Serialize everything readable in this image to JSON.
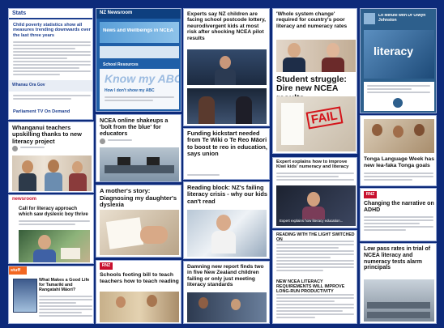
{
  "cards": {
    "stats": {
      "brand": "Stats",
      "headline": "Child poverty statistics show all measures trending downwards over the last three years",
      "footer_brand": "Whanau Ora Gov",
      "footer_text": "Parliament TV On Demand",
      "color": "#1d3f8f"
    },
    "news_school": {
      "top_label": "NZ Newsroom",
      "article_title": "News and Wellbeings in NCEA",
      "panel_label": "School Resources",
      "slogan": "Know my ABC",
      "caption": "How I don't show my ABC",
      "color": "#2a6fbd"
    },
    "experts": {
      "headline": "Experts say NZ children are facing school postcode lottery, neurodivergent kids at most risk after shocking NCEA pilot results",
      "color": "#1b2b4a"
    },
    "whole_system": {
      "headline": "'Whole system change' required for country's poor literacy and numeracy rates",
      "fail_label": "FAIL",
      "student_headline": "Student struggle: Dire new NCEA results"
    },
    "podcast": {
      "show_title": "Lit Minute with Dr Olwyn Johnston",
      "cover_word": "literacy",
      "color": "#2d5f8c"
    },
    "whanganui": {
      "headline": "Whanganui teachers upskilling thanks to new literacy project"
    },
    "ncea_shakeups": {
      "headline": "NCEA online shakeups a 'bolt from the blue' for educators"
    },
    "funding": {
      "headline": "Funding kickstart needed from Te Wiki o Te Reo Māori to boost te reo in education, says union"
    },
    "expert_improve": {
      "headline": "Expert explains how to improve Kiwi kids' numeracy and literacy",
      "video_caption": "Expert explains how literacy education..."
    },
    "tongan": {
      "headline": "Tonga Language Week has new lea-faka Tonga goals"
    },
    "dyslexia": {
      "headline": "A mother's story: Diagnosing my daughter's dyslexia"
    },
    "reading_block": {
      "headline": "Reading block: NZ's failing literacy crisis - why our kids can't read"
    },
    "call_for": {
      "headline": "Call for literacy approach which saw dyslexic boy thrive",
      "brand": "newsroom",
      "brand_color": "#c8102e"
    },
    "reading_light": {
      "headline": "READING WITH THE LIGHT SWITCHED ON",
      "ncea_headline": "NEW NCEA LITERACY REQUIREMENTS WILL IMPROVE LONG-RUN PRODUCTIVITY"
    },
    "adhd": {
      "brand": "RNZ",
      "headline": "Changing the narrative on ADHD",
      "brand_color": "#c8102e"
    },
    "low_pass": {
      "headline": "Low pass rates in trial of NCEA literacy and numeracy tests alarm principals"
    },
    "schools_footing": {
      "brand": "RNZ",
      "headline": "Schools footing bill to teach teachers how to teach reading",
      "brand_color": "#c8102e"
    },
    "damning": {
      "headline": "Damning new report finds two in five New Zealand children failing or only just meeting literacy standards"
    },
    "stuff_book": {
      "brand": "stuff",
      "headline": "What Makes a Good Life for Tamariki and Rangatahi Māori?",
      "brand_color": "#f26722"
    }
  }
}
